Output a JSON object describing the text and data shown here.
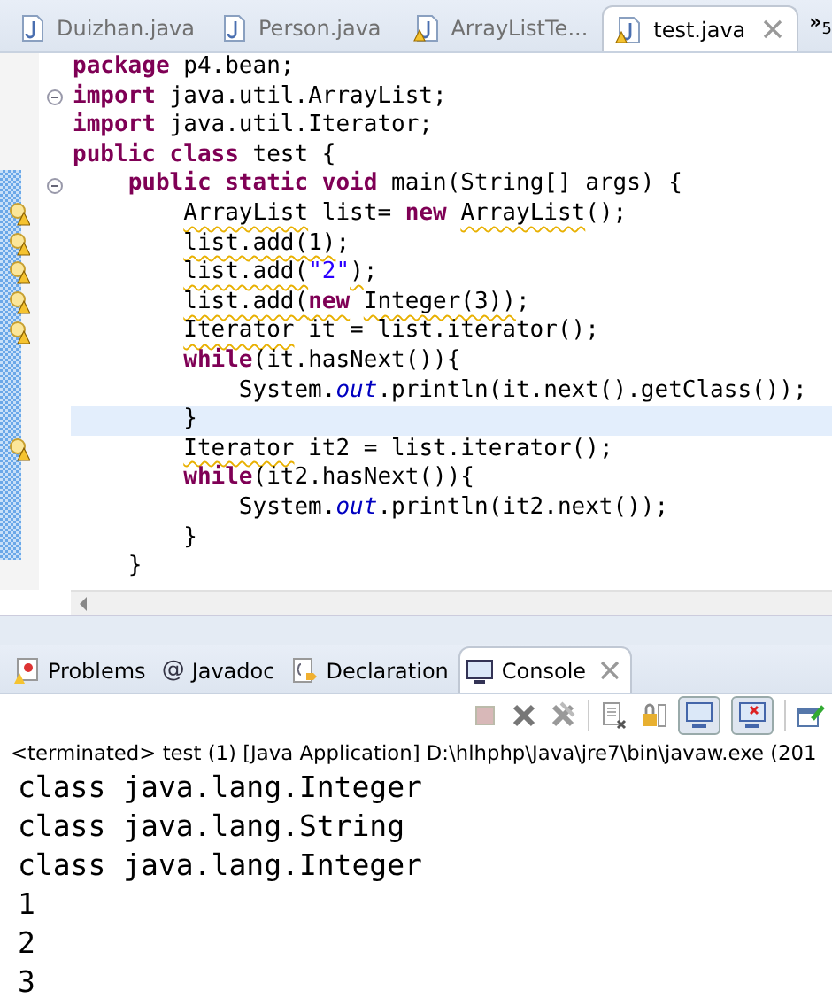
{
  "editor_tabs": [
    {
      "label": "Duizhan.java",
      "selected": false,
      "warning": false
    },
    {
      "label": "Person.java",
      "selected": false,
      "warning": false
    },
    {
      "label": "ArrayListTe...",
      "selected": false,
      "warning": true
    },
    {
      "label": "test.java",
      "selected": true,
      "warning": true
    }
  ],
  "editor_overflow": {
    "label": "»",
    "count": "5"
  },
  "code_lines": [
    {
      "warning": false,
      "fold": false,
      "current": false,
      "segments": [
        {
          "kind": "kw",
          "text": "package"
        },
        {
          "kind": "plain",
          "text": " p4.bean;"
        }
      ]
    },
    {
      "warning": false,
      "fold": true,
      "current": false,
      "segments": [
        {
          "kind": "kw",
          "text": "import"
        },
        {
          "kind": "plain",
          "text": " java.util.ArrayList;"
        }
      ]
    },
    {
      "warning": false,
      "fold": false,
      "current": false,
      "segments": [
        {
          "kind": "kw",
          "text": "import"
        },
        {
          "kind": "plain",
          "text": " java.util.Iterator;"
        }
      ]
    },
    {
      "warning": false,
      "fold": false,
      "current": false,
      "segments": [
        {
          "kind": "kw",
          "text": "public "
        },
        {
          "kind": "kw",
          "text": "class"
        },
        {
          "kind": "plain",
          "text": " test {"
        }
      ]
    },
    {
      "warning": false,
      "fold": true,
      "current": false,
      "segments": [
        {
          "kind": "kw",
          "text": "    public "
        },
        {
          "kind": "kw",
          "text": "static "
        },
        {
          "kind": "kw",
          "text": "void"
        },
        {
          "kind": "plain",
          "text": " main(String[] args) {"
        }
      ]
    },
    {
      "warning": true,
      "fold": false,
      "current": false,
      "segments": [
        {
          "kind": "warn",
          "text": "        ArrayList"
        },
        {
          "kind": "plain",
          "text": " list= "
        },
        {
          "kind": "kw",
          "text": "new "
        },
        {
          "kind": "warn",
          "text": "ArrayList"
        },
        {
          "kind": "plain",
          "text": "();"
        }
      ]
    },
    {
      "warning": true,
      "fold": false,
      "current": false,
      "segments": [
        {
          "kind": "warn",
          "text": "        list.add(1)"
        },
        {
          "kind": "plain",
          "text": ";"
        }
      ]
    },
    {
      "warning": true,
      "fold": false,
      "current": false,
      "segments": [
        {
          "kind": "warn",
          "text": "        list.add("
        },
        {
          "kind": "str",
          "text": "\"2\""
        },
        {
          "kind": "warn",
          "text": ")"
        },
        {
          "kind": "plain",
          "text": ";"
        }
      ]
    },
    {
      "warning": true,
      "fold": false,
      "current": false,
      "segments": [
        {
          "kind": "warn",
          "text": "        list.add("
        },
        {
          "kind": "warnkw",
          "text": "new"
        },
        {
          "kind": "warn",
          "text": " Integer(3))"
        },
        {
          "kind": "plain",
          "text": ";"
        }
      ]
    },
    {
      "warning": true,
      "fold": false,
      "current": false,
      "segments": [
        {
          "kind": "warn",
          "text": "        Iterator"
        },
        {
          "kind": "plain",
          "text": " it = list.iterator();"
        }
      ]
    },
    {
      "warning": false,
      "fold": false,
      "current": false,
      "segments": [
        {
          "kind": "kw",
          "text": "        while"
        },
        {
          "kind": "plain",
          "text": "(it.hasNext()){"
        }
      ]
    },
    {
      "warning": false,
      "fold": false,
      "current": false,
      "segments": [
        {
          "kind": "plain",
          "text": "            System."
        },
        {
          "kind": "field",
          "text": "out"
        },
        {
          "kind": "plain",
          "text": ".println(it.next().getClass());"
        }
      ]
    },
    {
      "warning": false,
      "fold": false,
      "current": true,
      "segments": [
        {
          "kind": "plain",
          "text": "        }"
        }
      ]
    },
    {
      "warning": true,
      "fold": false,
      "current": false,
      "segments": [
        {
          "kind": "warn",
          "text": "        Iterator"
        },
        {
          "kind": "plain",
          "text": " it2 = list.iterator();"
        }
      ]
    },
    {
      "warning": false,
      "fold": false,
      "current": false,
      "segments": [
        {
          "kind": "kw",
          "text": "        while"
        },
        {
          "kind": "plain",
          "text": "(it2.hasNext()){"
        }
      ]
    },
    {
      "warning": false,
      "fold": false,
      "current": false,
      "segments": [
        {
          "kind": "plain",
          "text": "            System."
        },
        {
          "kind": "field",
          "text": "out"
        },
        {
          "kind": "plain",
          "text": ".println(it2.next());"
        }
      ]
    },
    {
      "warning": false,
      "fold": false,
      "current": false,
      "segments": [
        {
          "kind": "plain",
          "text": "        }"
        }
      ]
    },
    {
      "warning": false,
      "fold": false,
      "current": false,
      "segments": [
        {
          "kind": "plain",
          "text": "    }"
        }
      ]
    }
  ],
  "view_tabs": [
    {
      "label": "Problems",
      "kind": "problems",
      "selected": false
    },
    {
      "label": "Javadoc",
      "kind": "javadoc",
      "symbol": "@",
      "selected": false
    },
    {
      "label": "Declaration",
      "kind": "declaration",
      "selected": false
    },
    {
      "label": "Console",
      "kind": "console",
      "selected": true
    }
  ],
  "console": {
    "status": "<terminated> test (1) [Java Application] D:\\hlhphp\\Java\\jre7\\bin\\javaw.exe (201",
    "output": [
      "class java.lang.Integer",
      "class java.lang.String",
      "class java.lang.Integer",
      "1",
      "2",
      "3"
    ]
  }
}
